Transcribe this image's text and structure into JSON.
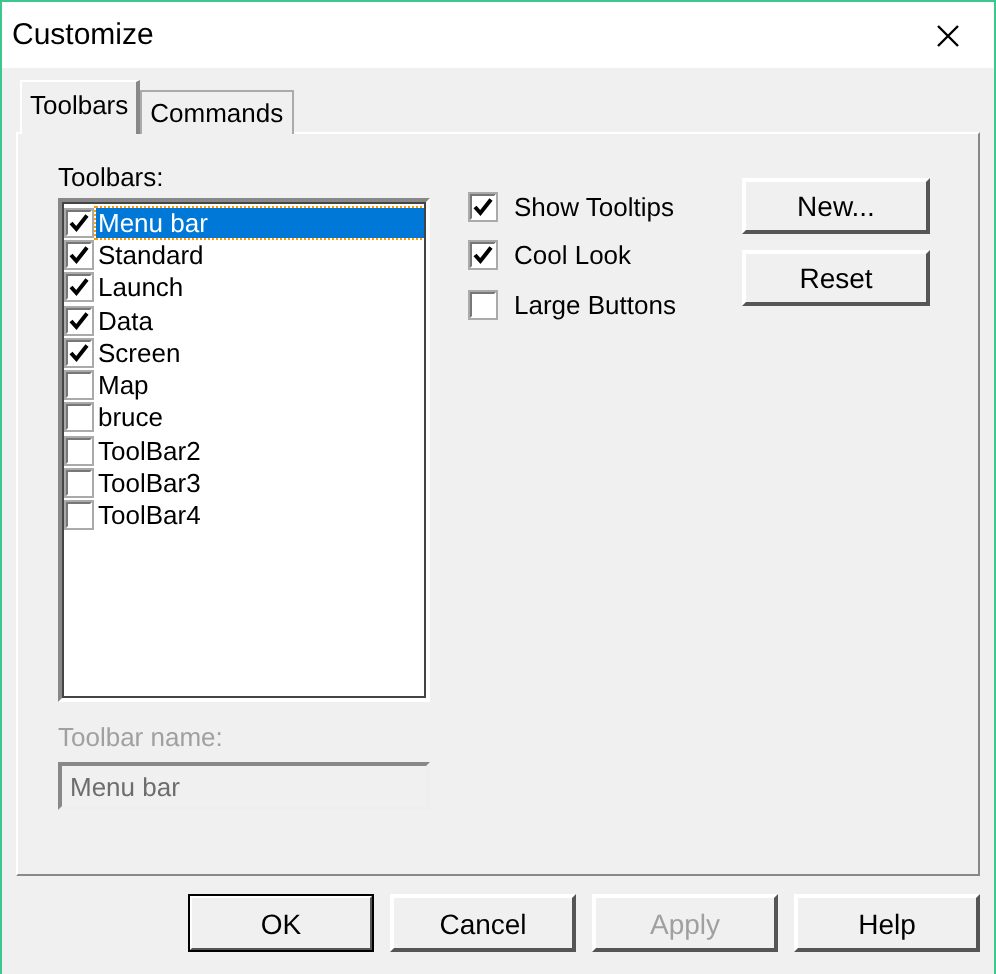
{
  "window": {
    "title": "Customize"
  },
  "tabs": [
    {
      "label": "Toolbars",
      "selected": true
    },
    {
      "label": "Commands",
      "selected": false
    }
  ],
  "toolbars_label": "Toolbars:",
  "toolbars": [
    {
      "label": "Menu bar",
      "checked": true,
      "selected": true
    },
    {
      "label": "Standard",
      "checked": true,
      "selected": false
    },
    {
      "label": "Launch",
      "checked": true,
      "selected": false
    },
    {
      "label": "Data",
      "checked": true,
      "selected": false
    },
    {
      "label": "Screen",
      "checked": true,
      "selected": false
    },
    {
      "label": "Map",
      "checked": false,
      "selected": false
    },
    {
      "label": "bruce",
      "checked": false,
      "selected": false
    },
    {
      "label": "ToolBar2",
      "checked": false,
      "selected": false
    },
    {
      "label": "ToolBar3",
      "checked": false,
      "selected": false
    },
    {
      "label": "ToolBar4",
      "checked": false,
      "selected": false
    }
  ],
  "options": [
    {
      "label": "Show Tooltips",
      "checked": true
    },
    {
      "label": "Cool Look",
      "checked": true
    },
    {
      "label": "Large Buttons",
      "checked": false
    }
  ],
  "side_buttons": [
    "New...",
    "Reset"
  ],
  "toolbar_name": {
    "label": "Toolbar name:",
    "value": "Menu bar",
    "disabled": true
  },
  "buttons": [
    {
      "label": "OK",
      "disabled": false,
      "default": true
    },
    {
      "label": "Cancel",
      "disabled": false,
      "default": false
    },
    {
      "label": "Apply",
      "disabled": true,
      "default": false
    },
    {
      "label": "Help",
      "disabled": false,
      "default": false
    }
  ]
}
